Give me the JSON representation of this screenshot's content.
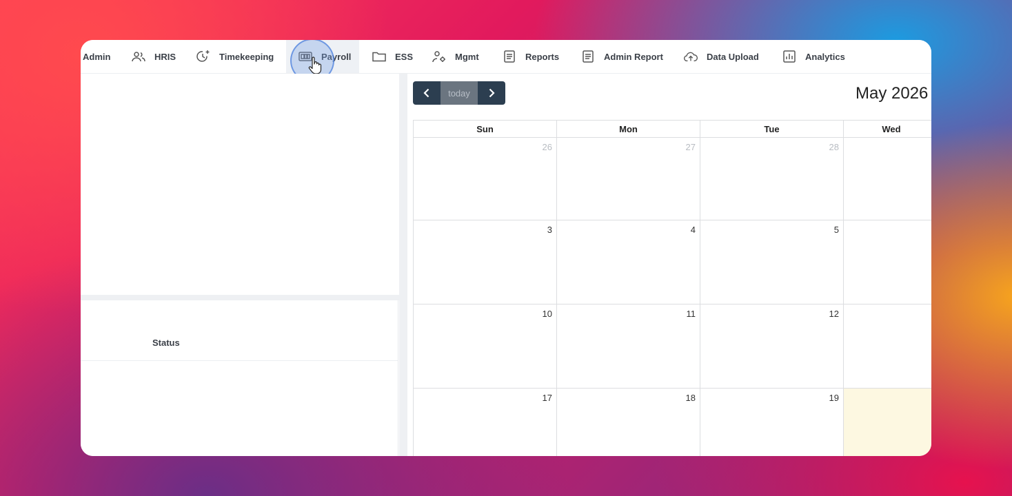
{
  "nav": {
    "items": [
      {
        "label": "Admin",
        "icon": "admin-icon"
      },
      {
        "label": "HRIS",
        "icon": "users-icon"
      },
      {
        "label": "Timekeeping",
        "icon": "clock-plus-icon"
      },
      {
        "label": "Payroll",
        "icon": "payroll-icon"
      },
      {
        "label": "ESS",
        "icon": "folder-icon"
      },
      {
        "label": "Mgmt",
        "icon": "user-settings-icon"
      },
      {
        "label": "Reports",
        "icon": "document-icon"
      },
      {
        "label": "Admin Report",
        "icon": "document-icon"
      },
      {
        "label": "Data Upload",
        "icon": "cloud-upload-icon"
      },
      {
        "label": "Analytics",
        "icon": "bar-chart-icon"
      }
    ],
    "active": "Payroll"
  },
  "left_panel": {
    "table_header_status": "Status"
  },
  "calendar": {
    "toolbar": {
      "prev": "‹",
      "today": "today",
      "next": "›"
    },
    "title": "May 2026",
    "weekdays": [
      "Sun",
      "Mon",
      "Tue",
      "Wed"
    ],
    "weeks": [
      [
        "26",
        "27",
        "28",
        ""
      ],
      [
        "3",
        "4",
        "5",
        ""
      ],
      [
        "10",
        "11",
        "12",
        ""
      ],
      [
        "17",
        "18",
        "19",
        ""
      ]
    ]
  },
  "colors": {
    "toolbar": "#2c3e50",
    "today_highlight": "#fdf8e1",
    "active_tab_bg": "#eef1f5"
  }
}
